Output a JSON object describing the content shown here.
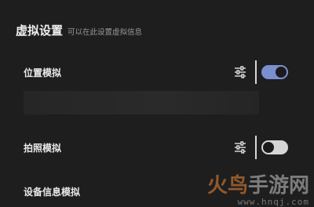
{
  "header": {
    "title": "虚拟设置",
    "subtitle": "可以在此设置虚拟信息"
  },
  "settings": [
    {
      "label": "位置模拟",
      "toggle": "on",
      "tune_icon": "sliders-icon"
    },
    {
      "label": "拍照模拟",
      "toggle": "off",
      "tune_icon": "sliders-icon"
    },
    {
      "label": "设备信息模拟"
    }
  ],
  "watermark": {
    "brand_orange": "火鸟",
    "brand_gray": "手游网",
    "url": "www.hnqj.com"
  },
  "colors": {
    "background": "#1e1e1e",
    "toggle_on": "#7b8fd0",
    "toggle_off": "#d6d6d6",
    "watermark_orange": "#f08a3a"
  }
}
